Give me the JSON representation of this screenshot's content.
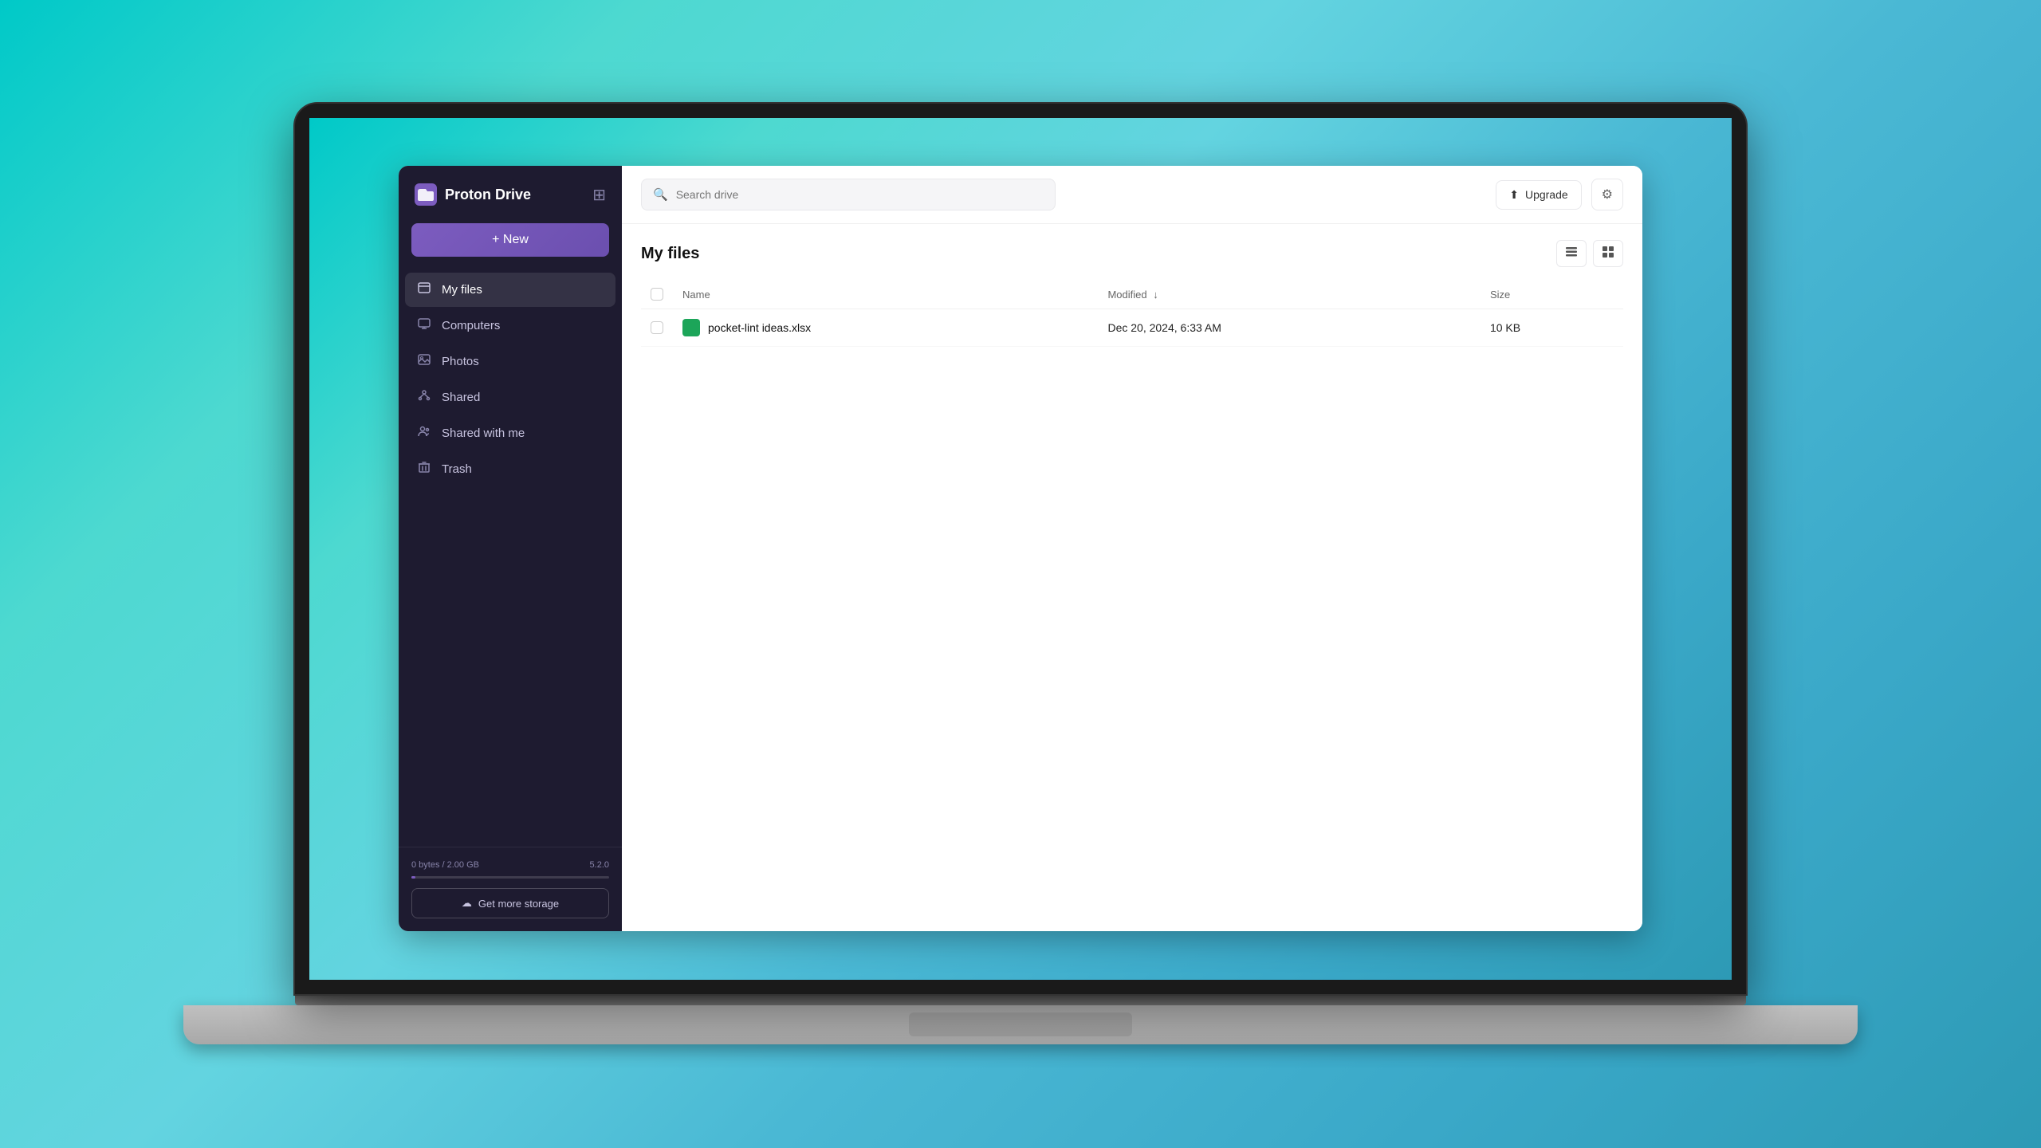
{
  "app": {
    "title": "Proton Drive"
  },
  "sidebar": {
    "logo_text": "Proton Drive",
    "new_button_label": "+ New",
    "nav_items": [
      {
        "id": "my-files",
        "label": "My files",
        "icon": "📄",
        "active": true
      },
      {
        "id": "computers",
        "label": "Computers",
        "icon": "💻",
        "active": false
      },
      {
        "id": "photos",
        "label": "Photos",
        "icon": "🖼️",
        "active": false
      },
      {
        "id": "shared",
        "label": "Shared",
        "icon": "🔗",
        "active": false
      },
      {
        "id": "shared-with-me",
        "label": "Shared with me",
        "icon": "👥",
        "active": false
      },
      {
        "id": "trash",
        "label": "Trash",
        "icon": "🗑️",
        "active": false
      }
    ],
    "storage": {
      "used": "0 bytes",
      "total": "2.00 GB",
      "version": "5.2.0",
      "percentage": 2
    },
    "get_storage_label": "Get more storage",
    "storage_icon": "☁️"
  },
  "header": {
    "search_placeholder": "Search drive",
    "upgrade_label": "Upgrade",
    "upgrade_icon": "⬆",
    "settings_icon": "⚙"
  },
  "main": {
    "title": "My files",
    "columns": {
      "name": "Name",
      "modified": "Modified",
      "modified_sorted": true,
      "size": "Size"
    },
    "files": [
      {
        "name": "pocket-lint ideas.xlsx",
        "modified": "Dec 20, 2024, 6:33 AM",
        "size": "10 KB",
        "type": "xlsx",
        "icon_color": "#1ca559"
      }
    ]
  }
}
